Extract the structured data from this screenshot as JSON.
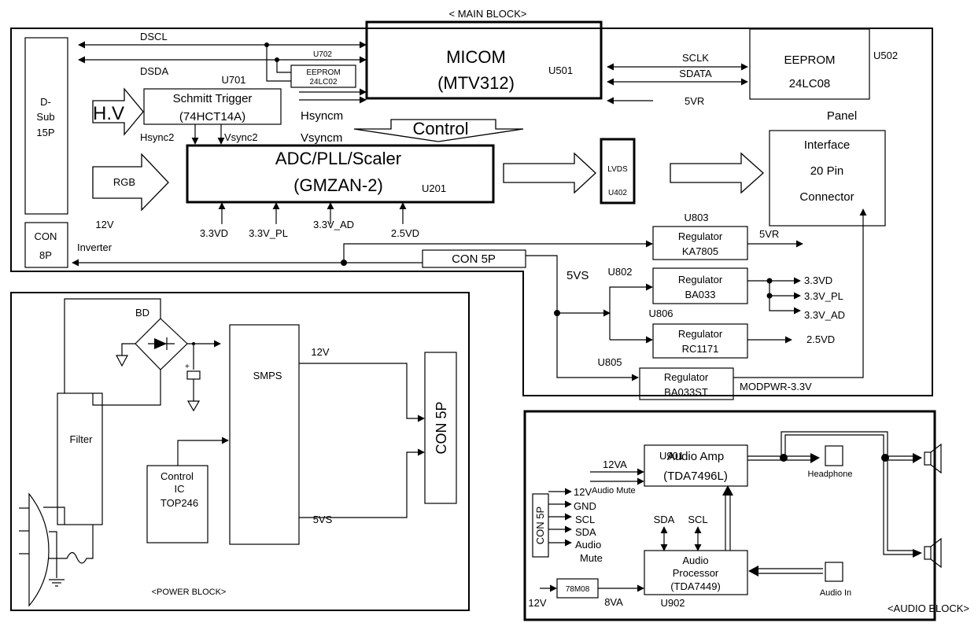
{
  "main_block": {
    "title": "< MAIN BLOCK>",
    "dsub": [
      "D-",
      "Sub",
      "15P"
    ],
    "con8p": [
      "CON",
      "8P"
    ],
    "dscl": "DSCL",
    "dsda": "DSDA",
    "u702": "U702",
    "eeprom_small": [
      "EEPROM",
      "24LC02"
    ],
    "micom": [
      "MICOM",
      "(MTV312)"
    ],
    "u501": "U501",
    "sclk": "SCLK",
    "sdata": "SDATA",
    "vr5_in": "5VR",
    "eeprom": [
      "EEPROM",
      "24LC08"
    ],
    "u502": "U502",
    "u701": "U701",
    "hv": "H.V",
    "schmitt": [
      "Schmitt Trigger",
      "(74HCT14A)"
    ],
    "hsyncm": "Hsyncm",
    "vsyncm": "Vsyncm",
    "control": "Control",
    "hsync2": "Hsync2",
    "vsync2": "Vsync2",
    "rgb": "RGB",
    "scaler": [
      "ADC/PLL/Scaler",
      "(GMZAN-2)"
    ],
    "u201": "U201",
    "scaler_inputs": [
      "3.3VD",
      "3.3V_PL",
      "3.3V_AD",
      "2.5VD"
    ],
    "lvds": [
      "LVDS",
      "U402"
    ],
    "panel": "Panel",
    "interface": [
      "Interface",
      "20 Pin",
      "Connector"
    ],
    "v12": "12V",
    "inverter": "Inverter",
    "con5p": "CON 5P",
    "v5vs": "5VS",
    "regulators": [
      {
        "id": "U803",
        "name": "Regulator",
        "part": "KA7805",
        "out": "5VR"
      },
      {
        "id": "U802",
        "name": "Regulator",
        "part": "BA033",
        "out": [
          "3.3VD",
          "3.3V_PL",
          "3.3V_AD"
        ]
      },
      {
        "id": "U806",
        "name": "Regulator",
        "part": "RC1171",
        "out": "2.5VD"
      },
      {
        "id": "U805",
        "name": "Regulator",
        "part": "BA033ST",
        "out": "MODPWR-3.3V"
      }
    ]
  },
  "power_block": {
    "title": "<POWER BLOCK>",
    "bd": "BD",
    "filter": "Filter",
    "smps": "SMPS",
    "control_ic": [
      "Control",
      "IC",
      "TOP246"
    ],
    "out_12v": "12V",
    "out_5vs": "5VS",
    "con5p": "CON 5P"
  },
  "audio_block": {
    "title": "<AUDIO BLOCK>",
    "u901": "U901",
    "v12va": "12VA",
    "audio_mute": "Audio Mute",
    "amp": [
      "Audio Amp",
      "(TDA7496L)"
    ],
    "con5p": "CON 5P",
    "con_pins": [
      "12V",
      "GND",
      "SCL",
      "SDA",
      "Audio",
      "Mute"
    ],
    "sda": "SDA",
    "scl": "SCL",
    "processor": [
      "Audio",
      "Processor",
      "(TDA7449)"
    ],
    "reg": "78M08",
    "v12": "12V",
    "v8va": "8VA",
    "u902": "U902",
    "headphone": "Headphone",
    "audio_in": "Audio In"
  }
}
